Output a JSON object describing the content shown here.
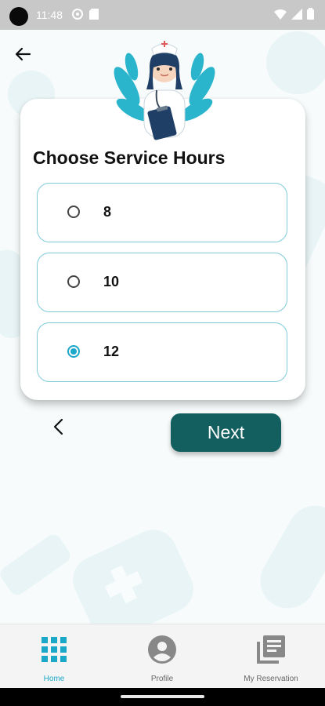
{
  "status_bar": {
    "time": "11:48"
  },
  "card": {
    "title": "Choose Service Hours",
    "options": [
      {
        "label": "8",
        "selected": false
      },
      {
        "label": "10",
        "selected": false
      },
      {
        "label": "12",
        "selected": true
      }
    ]
  },
  "actions": {
    "next_label": "Next"
  },
  "bottom_nav": {
    "items": [
      {
        "label": "Home",
        "icon": "grid-icon",
        "active": true
      },
      {
        "label": "Profile",
        "icon": "person-icon",
        "active": false
      },
      {
        "label": "My Reservation",
        "icon": "library-icon",
        "active": false
      }
    ]
  },
  "colors": {
    "accent": "#1ba8c8",
    "button": "#135e5e",
    "border": "#7fcad8"
  }
}
